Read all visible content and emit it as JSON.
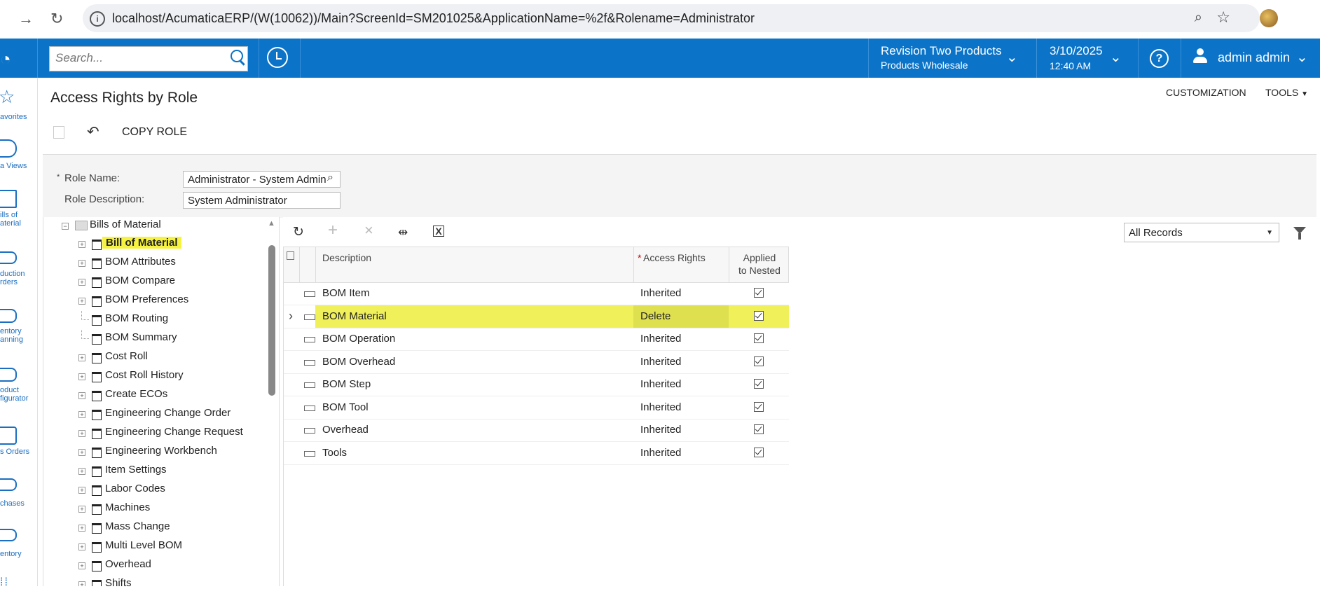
{
  "browser": {
    "back": "←",
    "forward": "→",
    "reload": "↻",
    "url": "localhost/AcumaticaERP/(W(10062))/Main?ScreenId=SM201025&ApplicationName=%2f&Rolename=Administrator"
  },
  "header": {
    "search_placeholder": "Search...",
    "branch_name": "Revision Two Products",
    "branch_sub": "Products Wholesale",
    "date": "3/10/2025",
    "time": "12:40 AM",
    "help": "?",
    "user": "admin admin"
  },
  "sidebar": {
    "items": [
      {
        "label": "avorites",
        "icon": "star-icon"
      },
      {
        "label": "a Views",
        "icon": "pie-chart-icon"
      },
      {
        "label": "ills of\naterial",
        "icon": "bill-icon"
      },
      {
        "label": "duction\nrders",
        "icon": "truck-icon"
      },
      {
        "label": "entory\nanning",
        "icon": "cart-plus-icon"
      },
      {
        "label": "oduct\nfigurator",
        "icon": "wrench-icon"
      },
      {
        "label": "s Orders",
        "icon": "pencil-icon"
      },
      {
        "label": "chases",
        "icon": "cart-icon"
      },
      {
        "label": "entory",
        "icon": "truck-icon"
      }
    ]
  },
  "page": {
    "title": "Access Rights by Role",
    "customization": "CUSTOMIZATION",
    "tools": "TOOLS",
    "copy_role": "COPY ROLE"
  },
  "form": {
    "role_name_label": "Role Name:",
    "role_name_value": "Administrator - System Admin",
    "role_desc_label": "Role Description:",
    "role_desc_value": "System Administrator"
  },
  "tree": {
    "root": "Bills of Material",
    "items": [
      {
        "label": "Bill of Material",
        "selected": true,
        "expandable": true
      },
      {
        "label": "BOM Attributes",
        "expandable": true
      },
      {
        "label": "BOM Compare",
        "expandable": true
      },
      {
        "label": "BOM Preferences",
        "expandable": true
      },
      {
        "label": "BOM Routing",
        "expandable": false
      },
      {
        "label": "BOM Summary",
        "expandable": false
      },
      {
        "label": "Cost Roll",
        "expandable": true
      },
      {
        "label": "Cost Roll History",
        "expandable": true
      },
      {
        "label": "Create ECOs",
        "expandable": true
      },
      {
        "label": "Engineering Change Order",
        "expandable": true
      },
      {
        "label": "Engineering Change Request",
        "expandable": true
      },
      {
        "label": "Engineering Workbench",
        "expandable": true
      },
      {
        "label": "Item Settings",
        "expandable": true
      },
      {
        "label": "Labor Codes",
        "expandable": true
      },
      {
        "label": "Machines",
        "expandable": true
      },
      {
        "label": "Mass Change",
        "expandable": true
      },
      {
        "label": "Multi Level BOM",
        "expandable": true
      },
      {
        "label": "Overhead",
        "expandable": true
      },
      {
        "label": "Shifts",
        "expandable": true
      }
    ]
  },
  "grid": {
    "filter_value": "All Records",
    "columns": {
      "description": "Description",
      "access_rights": "Access Rights",
      "applied_1": "Applied",
      "applied_2": "to Nested"
    },
    "rows": [
      {
        "description": "BOM Item",
        "access": "Inherited",
        "nested": true
      },
      {
        "description": "BOM Material",
        "access": "Delete",
        "nested": true,
        "selected": true
      },
      {
        "description": "BOM Operation",
        "access": "Inherited",
        "nested": true
      },
      {
        "description": "BOM Overhead",
        "access": "Inherited",
        "nested": true
      },
      {
        "description": "BOM Step",
        "access": "Inherited",
        "nested": true
      },
      {
        "description": "BOM Tool",
        "access": "Inherited",
        "nested": true
      },
      {
        "description": "Overhead",
        "access": "Inherited",
        "nested": true
      },
      {
        "description": "Tools",
        "access": "Inherited",
        "nested": true
      }
    ]
  },
  "colors": {
    "brand": "#0b74c8",
    "highlight": "#f0f05a",
    "link": "#1a6fc2"
  }
}
